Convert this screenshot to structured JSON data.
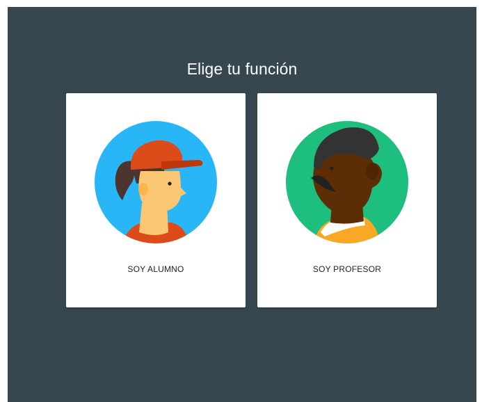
{
  "page": {
    "title": "Elige tu función",
    "background_color": "#37474f"
  },
  "roles": [
    {
      "label": "SOY ALUMNO",
      "icon": "student-avatar-icon",
      "circle_color": "#29b6f6"
    },
    {
      "label": "SOY PROFESOR",
      "icon": "teacher-avatar-icon",
      "circle_color": "#1ebe7e"
    }
  ]
}
